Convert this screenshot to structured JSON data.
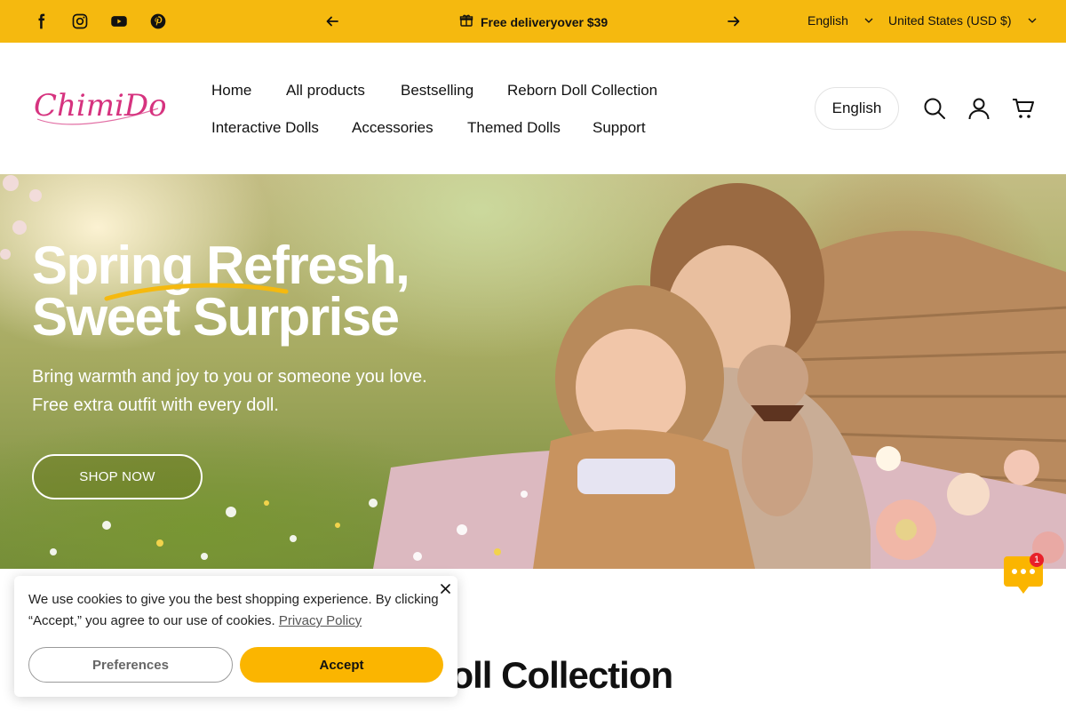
{
  "topbar": {
    "background": "#f5b90f",
    "socials": [
      "facebook-icon",
      "instagram-icon",
      "youtube-icon",
      "pinterest-icon"
    ],
    "announcement": "Free deliveryover $39",
    "language": "English",
    "currency": "United States (USD $)"
  },
  "header": {
    "logo_text": "ChimiDoll",
    "logo_color": "#d6337f",
    "nav": [
      "Home",
      "All products",
      "Bestselling",
      "Reborn Doll Collection",
      "Interactive Dolls",
      "Accessories",
      "Themed Dolls",
      "Support"
    ],
    "language_button": "English",
    "icons": [
      "search-icon",
      "account-icon",
      "cart-icon"
    ]
  },
  "hero": {
    "title": "Spring Refresh, Sweet Surprise",
    "subtitle_line1": "Bring warmth and joy to you or someone you love.",
    "subtitle_line2": "Free extra outfit with every doll.",
    "button": "SHOP NOW"
  },
  "section": {
    "title": "n Doll Collection"
  },
  "cookie": {
    "text": "We use cookies to give you the best shopping experience. By clicking “Accept,” you agree to our use of cookies.",
    "link": "Privacy Policy",
    "preferences": "Preferences",
    "accept": "Accept",
    "accent": "#fbb500"
  },
  "chat": {
    "badge": "1",
    "color": "#fbb500"
  }
}
